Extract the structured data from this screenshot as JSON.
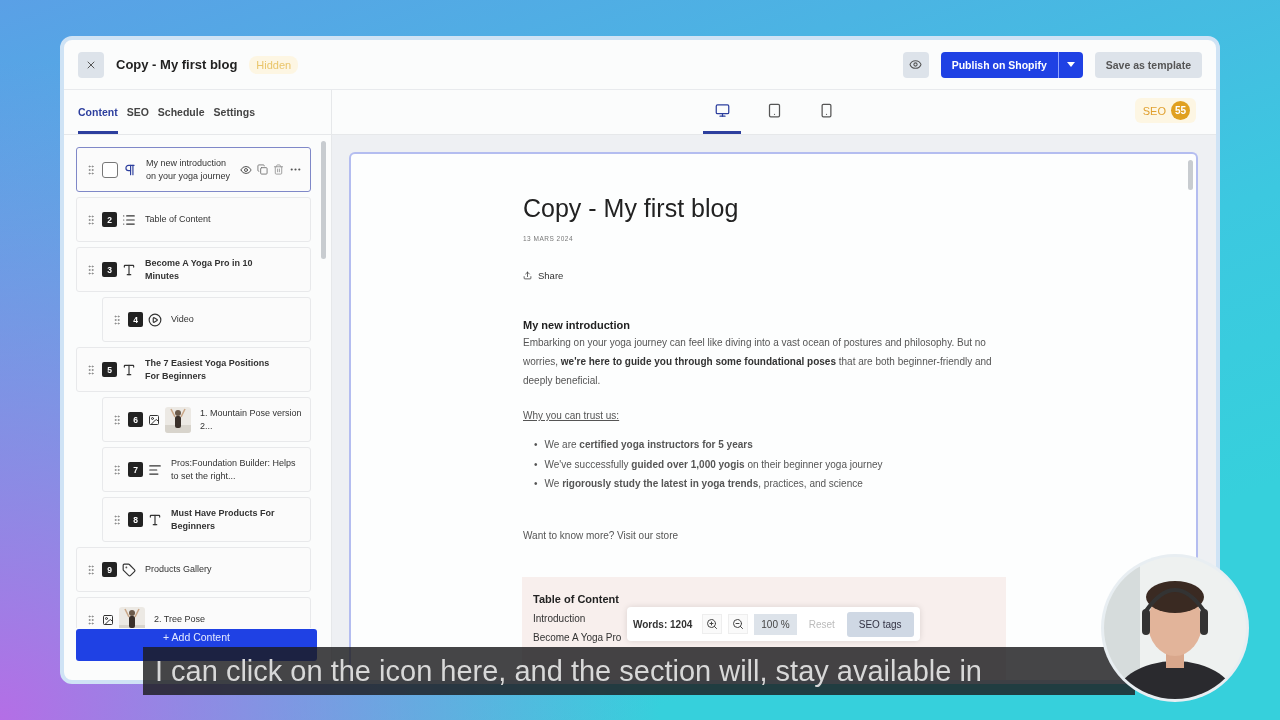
{
  "window": {
    "title": "Copy - My first blog",
    "status": "Hidden",
    "publish": "Publish on Shopify",
    "save": "Save as template"
  },
  "sidebar": {
    "tabs": [
      {
        "label": "Content",
        "selected": true
      },
      {
        "label": "SEO",
        "selected": false
      },
      {
        "label": "Schedule",
        "selected": false
      },
      {
        "label": "Settings",
        "selected": false
      }
    ],
    "blocks": [
      {
        "kind": "paragraph",
        "checked": false,
        "selected": true,
        "text": "My new introduction",
        "text_2": "on your yoga journey"
      },
      {
        "kind": "toc",
        "number": "2",
        "selected": false,
        "text": "Table of Content"
      },
      {
        "kind": "heading",
        "number": "3",
        "selected": false,
        "text": "Become A Yoga Pro in 10 Minutes",
        "children": [
          {
            "kind": "video",
            "number": "4",
            "selected": false,
            "text": "Video"
          }
        ]
      },
      {
        "kind": "heading",
        "number": "5",
        "selected": false,
        "text": "The 7 Easiest Yoga Positions For Beginners",
        "children": [
          {
            "kind": "image_text",
            "number": "6",
            "selected": false,
            "text": "1. Mountain Pose version 2..."
          },
          {
            "kind": "list",
            "number": "7",
            "selected": false,
            "text": "Pros:Foundation Builder: Helps to set the right..."
          },
          {
            "kind": "heading",
            "number": "8",
            "selected": false,
            "text": "Must Have Products For Beginners"
          }
        ]
      },
      {
        "kind": "products",
        "number": "9",
        "selected": false,
        "text": "Products Gallery"
      },
      {
        "kind": "image_text",
        "selected": false,
        "text": "2. Tree Pose"
      }
    ],
    "add_button": "+ Add Content"
  },
  "preview": {
    "devices": [
      {
        "kind": "desktop",
        "selected": true
      },
      {
        "kind": "tablet",
        "selected": false
      },
      {
        "kind": "mobile",
        "selected": false
      }
    ],
    "seo": {
      "label": "SEO",
      "score": "55"
    },
    "article": {
      "title": "Copy - My first blog",
      "date": "13 MARS 2024",
      "share": "Share",
      "intro_heading": "My new introduction",
      "intro": "Embarking  on your yoga journey can feel like diving into a vast ocean of postures and philosophy. But no worries, **we're here to guide you through some foundational poses** that are both beginner-friendly and deeply beneficial.",
      "trust_link": "Why you can trust us:",
      "bullet_marker": "•",
      "bullets": [
        "We are **certified yoga instructors for 5 years**",
        "We've successfully **guided over 1,000 yogis** on their beginner yoga journey",
        "We **rigorously study the latest in yoga trends**, practices, and science"
      ],
      "cta": "Want to know more? Visit our store",
      "toc": {
        "title": "Table of Content",
        "items": [
          "Introduction",
          "Become A Yoga Pro"
        ]
      }
    },
    "toolbar": {
      "words": "Words: 1204",
      "zoom": "100 %",
      "reset": "Reset",
      "reset_disabled": true,
      "seo_tags": "SEO tags"
    }
  },
  "subtitle": "I can click on the icon here, and the section will, stay available in"
}
